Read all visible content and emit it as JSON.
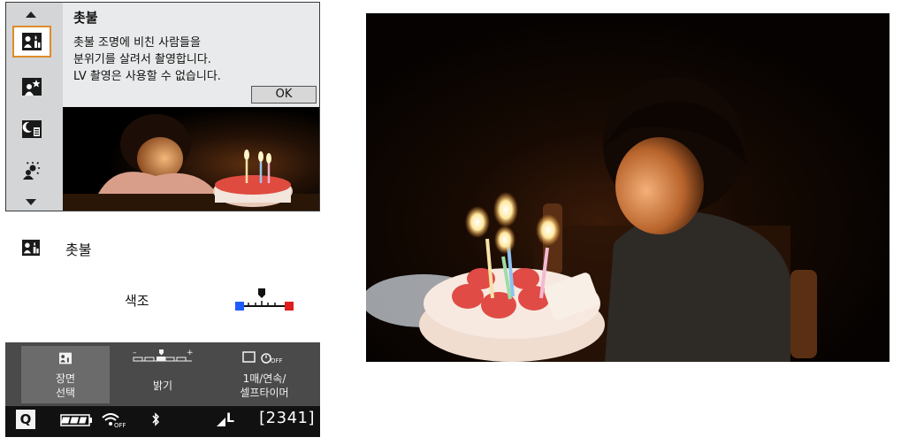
{
  "panel1": {
    "side_icons": [
      "candlelight-mode-icon",
      "night-portrait-icon",
      "handheld-night-icon",
      "hdr-backlight-icon"
    ],
    "title": "촛불",
    "description": [
      "촛불 조명에 비친 사람들을",
      "분위기를 살려서 촬영합니다.",
      "LV 촬영은 사용할 수 없습니다."
    ],
    "ok_label": "OK"
  },
  "panel2": {
    "title": "촛불",
    "setting_label": "색조",
    "bottom": {
      "scene_select": [
        "장면",
        "선택"
      ],
      "brightness": "밝기",
      "drive_mode": [
        "1매/연속/",
        "셀프타이머"
      ]
    },
    "status": {
      "q_label": "Q",
      "quality": "L",
      "shots_remaining": "[2341]"
    }
  },
  "colors": {
    "selection": "#e08a2a",
    "tone_blue": "#1d5cff",
    "tone_red": "#e01c1c"
  }
}
